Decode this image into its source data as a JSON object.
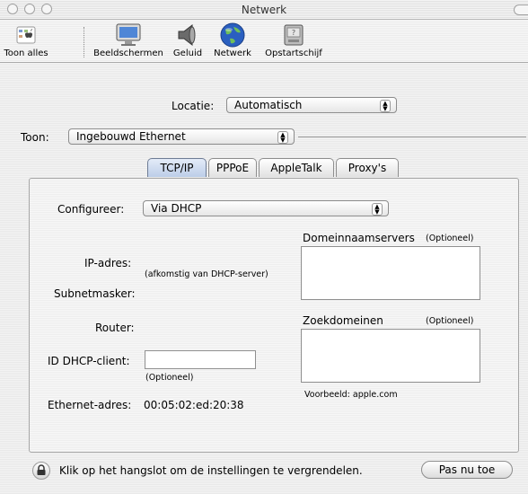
{
  "window": {
    "title": "Netwerk"
  },
  "toolbar": {
    "items": [
      {
        "label": "Toon alles",
        "icon": "apple-grid-icon"
      },
      {
        "label": "Beeldschermen",
        "icon": "display-icon"
      },
      {
        "label": "Geluid",
        "icon": "speaker-icon"
      },
      {
        "label": "Netwerk",
        "icon": "globe-icon"
      },
      {
        "label": "Opstartschijf",
        "icon": "disk-icon"
      }
    ]
  },
  "location": {
    "label": "Locatie:",
    "value": "Automatisch"
  },
  "show": {
    "label": "Toon:",
    "value": "Ingebouwd Ethernet"
  },
  "tabs": [
    {
      "label": "TCP/IP",
      "active": true
    },
    {
      "label": "PPPoE",
      "active": false
    },
    {
      "label": "AppleTalk",
      "active": false
    },
    {
      "label": "Proxy's",
      "active": false
    }
  ],
  "tcpip": {
    "configure_label": "Configureer:",
    "configure_value": "Via DHCP",
    "ip_label": "IP-adres:",
    "ip_note": "(afkomstig van DHCP-server)",
    "subnet_label": "Subnetmasker:",
    "router_label": "Router:",
    "dhcp_client_label": "ID DHCP-client:",
    "dhcp_client_value": "",
    "optional_note": "(Optioneel)",
    "ethernet_label": "Ethernet-adres:",
    "ethernet_value": "00:05:02:ed:20:38",
    "dns_label": "Domeinnaamservers",
    "dns_optional": "(Optioneel)",
    "search_label": "Zoekdomeinen",
    "search_optional": "(Optioneel)",
    "example_note": "Voorbeeld: apple.com"
  },
  "footer": {
    "lock_text": "Klik op het hangslot om de instellingen te vergrendelen.",
    "apply_label": "Pas nu toe"
  },
  "colors": {
    "active_tab": "#bccde8",
    "globe": "#2a5fc0"
  }
}
